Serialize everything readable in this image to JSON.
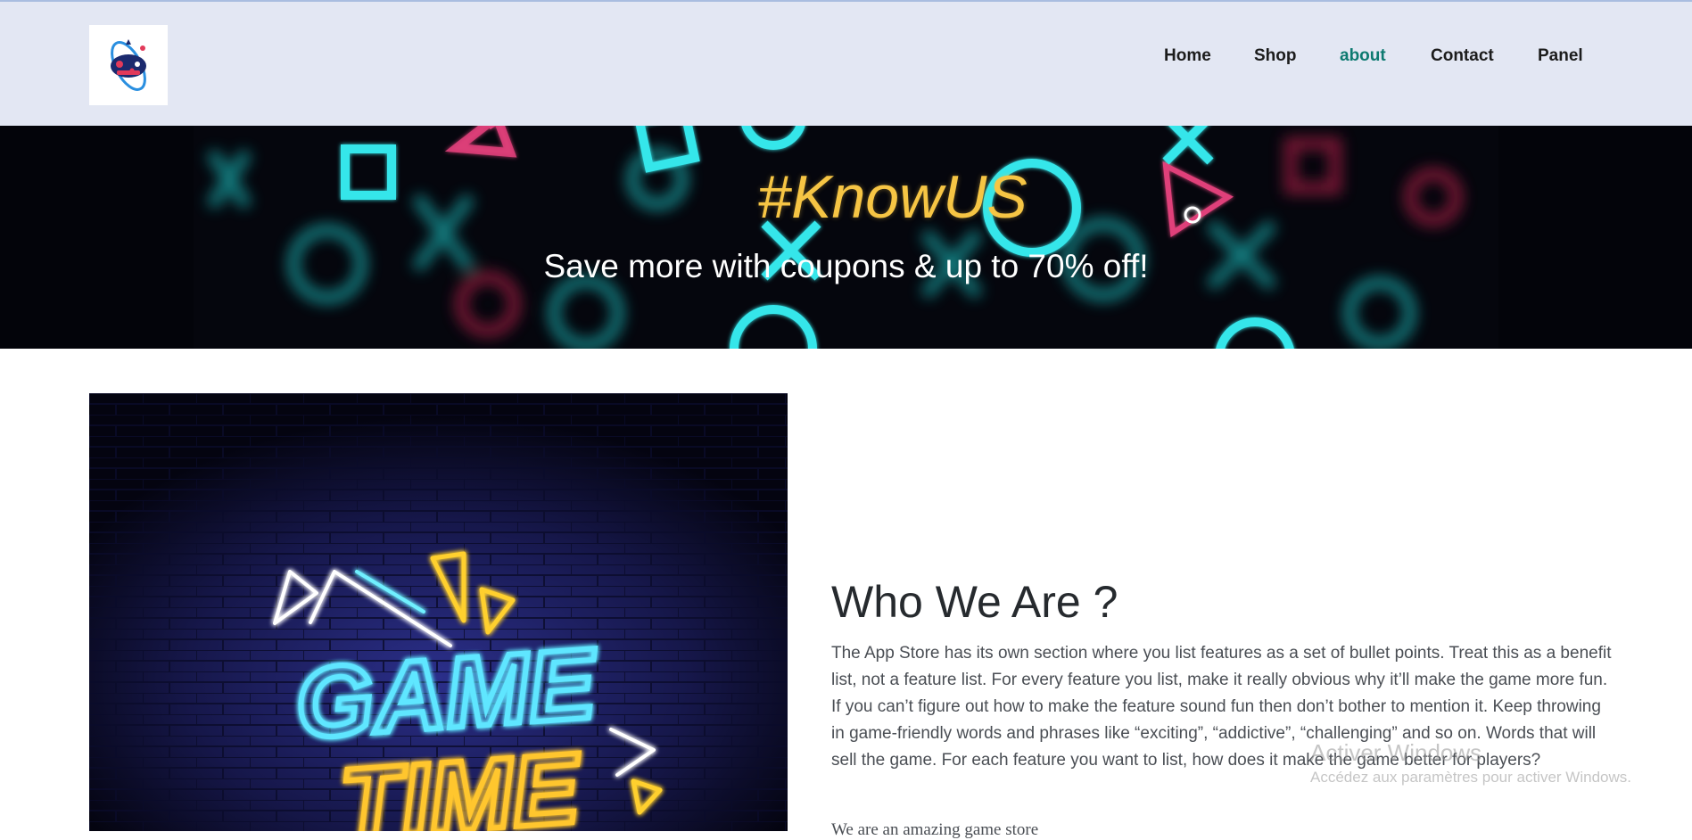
{
  "header": {
    "logo_icon": "gamepad-orbit-logo",
    "nav": [
      {
        "label": "Home"
      },
      {
        "label": "Shop"
      },
      {
        "label": "about",
        "active": true
      },
      {
        "label": "Contact"
      },
      {
        "label": "Panel"
      }
    ],
    "active_color": "#0d7a70"
  },
  "banner": {
    "title": "#KnowUS",
    "subtitle": "Save more with coupons & up to 70% off!",
    "title_color": "#f6c544"
  },
  "main": {
    "image_icon": "game-time-neon-sign",
    "image_text_line1": "GAME",
    "image_text_line2": "TIME",
    "heading": "Who We Are ?",
    "paragraph": "The App Store has its own section where you list features as a set of bullet points. Treat this as a benefit list, not a feature list. For every feature you list, make it really obvious why it’ll make the game more fun. If you can’t figure out how to make the feature sound fun then don’t bother to mention it. Keep throwing in game-friendly words and phrases like “exciting”, “addictive”, “challenging” and so on. Words that will sell the game. For each feature you want to list, how does it make the game better for players?",
    "paragraph2": "We are an amazing game store"
  },
  "watermark": {
    "line1": "Activer Windows",
    "line2": "Accédez aux paramètres pour activer Windows."
  }
}
